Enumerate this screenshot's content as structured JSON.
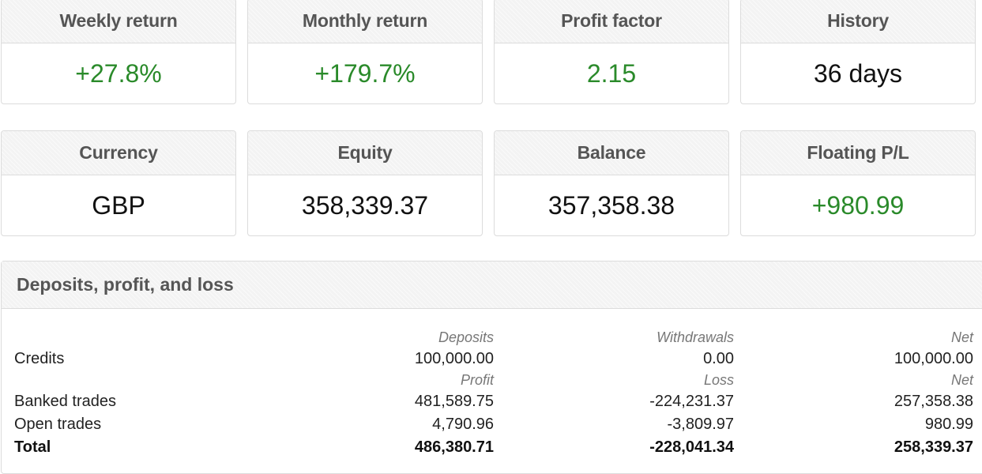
{
  "stats": [
    {
      "label": "Weekly return",
      "value": "+27.8%",
      "positive": true
    },
    {
      "label": "Monthly return",
      "value": "+179.7%",
      "positive": true
    },
    {
      "label": "Profit factor",
      "value": "2.15",
      "positive": true
    },
    {
      "label": "History",
      "value": "36 days",
      "positive": false
    },
    {
      "label": "Currency",
      "value": "GBP",
      "positive": false
    },
    {
      "label": "Equity",
      "value": "358,339.37",
      "positive": false
    },
    {
      "label": "Balance",
      "value": "357,358.38",
      "positive": false
    },
    {
      "label": "Floating P/L",
      "value": "+980.99",
      "positive": true
    }
  ],
  "colors": {
    "positive": "#2a8a2a",
    "neutral": "#111111"
  },
  "deposits_panel": {
    "title": "Deposits, profit, and loss",
    "credits_headers": [
      "Deposits",
      "Withdrawals",
      "Net"
    ],
    "credits": {
      "label": "Credits",
      "values": [
        "100,000.00",
        "0.00",
        "100,000.00"
      ]
    },
    "trades_headers": [
      "Profit",
      "Loss",
      "Net"
    ],
    "rows": [
      {
        "label": "Banked trades",
        "values": [
          "481,589.75",
          "-224,231.37",
          "257,358.38"
        ]
      },
      {
        "label": "Open trades",
        "values": [
          "4,790.96",
          "-3,809.97",
          "980.99"
        ]
      }
    ],
    "total": {
      "label": "Total",
      "values": [
        "486,380.71",
        "-228,041.34",
        "258,339.37"
      ]
    }
  }
}
